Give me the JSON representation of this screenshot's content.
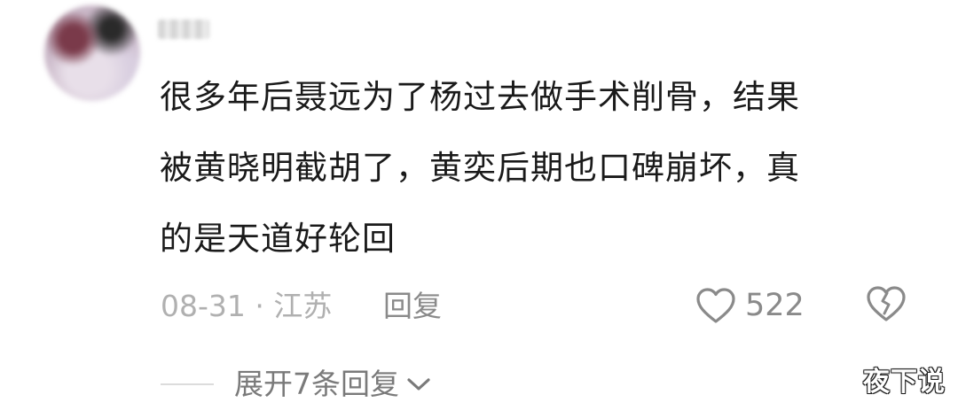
{
  "comment": {
    "username": "",
    "lines": [
      "很多年后聂远为了杨过去做手术削骨，结果",
      "被黄晓明截胡了，黄奕后期也口碑崩坏，真",
      "的是天道好轮回"
    ],
    "meta": "08-31 · 江苏",
    "reply_label": "回复",
    "like_count": "522"
  },
  "expand": {
    "label": "展开7条回复"
  },
  "watermark": "夜下说",
  "colors": {
    "text": "#1a1a1a",
    "meta": "#b0b0b0",
    "action": "#8a8a8a"
  },
  "icons": {
    "like": "heart-outline-icon",
    "dislike": "broken-heart-icon",
    "expand": "chevron-down-icon"
  }
}
